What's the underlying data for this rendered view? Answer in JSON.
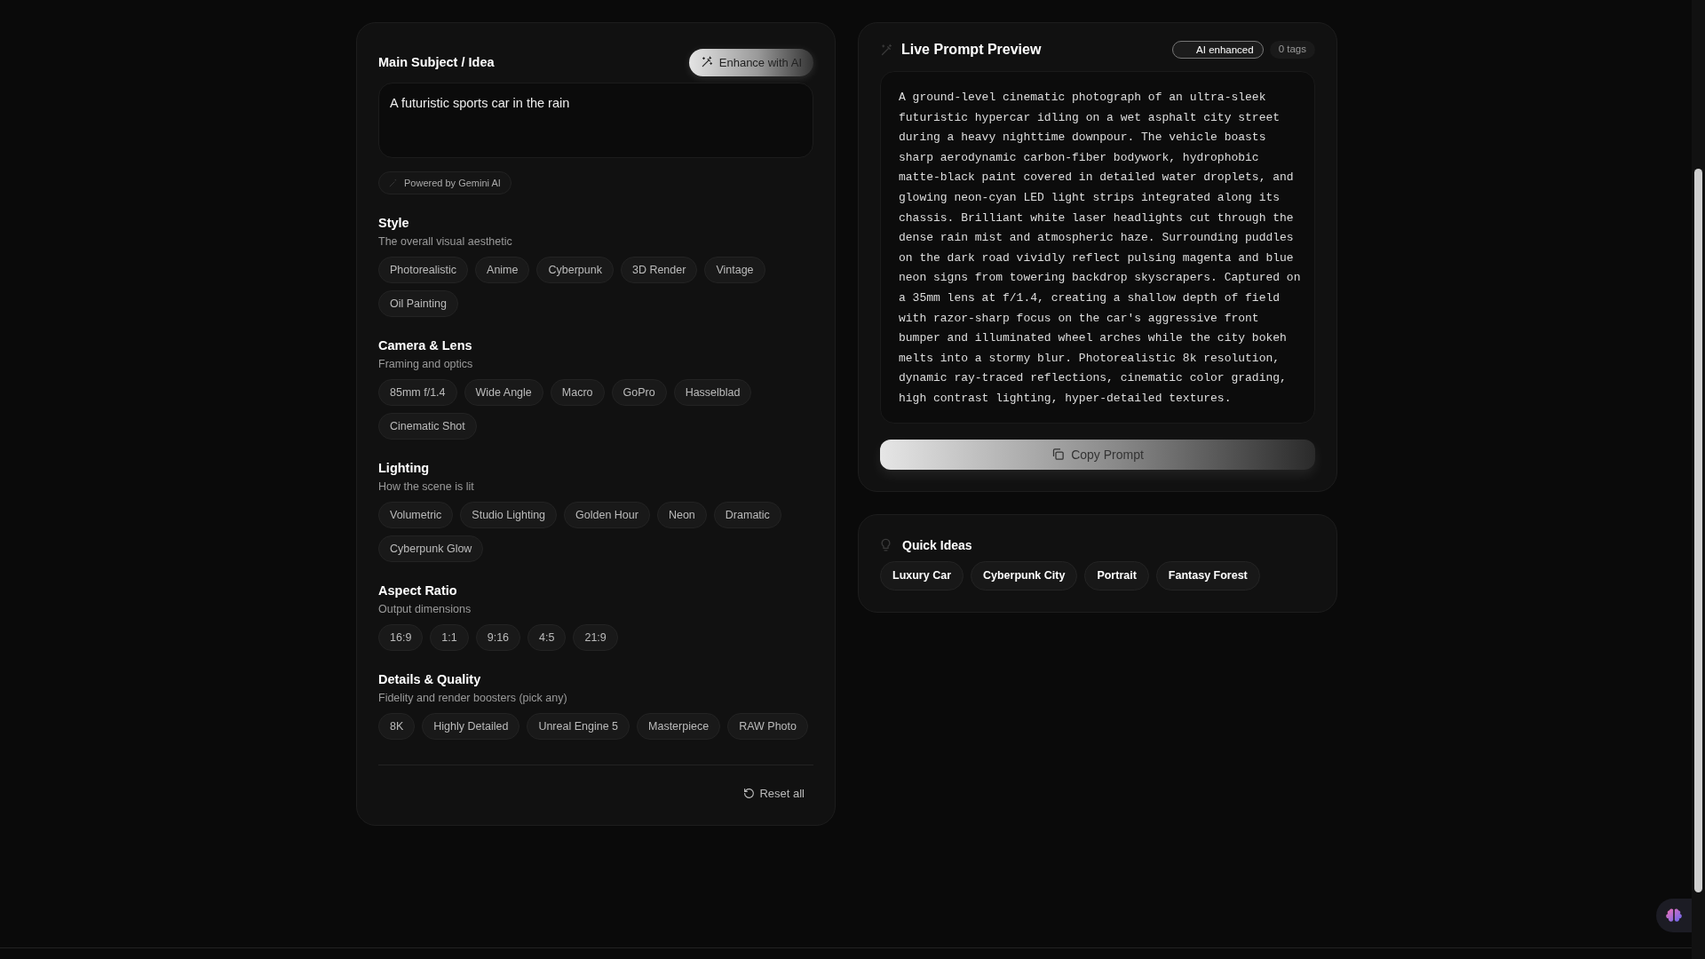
{
  "subject": {
    "title": "Main Subject / Idea",
    "enhance_button": "Enhance with AI",
    "value": "A futuristic sports car in the rain",
    "powered_by": "Powered by Gemini AI"
  },
  "sections": [
    {
      "title": "Style",
      "subtitle": "The overall visual aesthetic",
      "chips": [
        {
          "label": "Photorealistic",
          "selected": false
        },
        {
          "label": "Anime",
          "selected": false
        },
        {
          "label": "Cyberpunk",
          "selected": false
        },
        {
          "label": "3D Render",
          "selected": false
        },
        {
          "label": "Vintage",
          "selected": false
        },
        {
          "label": "Oil Painting",
          "selected": false
        }
      ]
    },
    {
      "title": "Camera & Lens",
      "subtitle": "Framing and optics",
      "chips": [
        {
          "label": "85mm f/1.4",
          "selected": false
        },
        {
          "label": "Wide Angle",
          "selected": false
        },
        {
          "label": "Macro",
          "selected": false
        },
        {
          "label": "GoPro",
          "selected": false
        },
        {
          "label": "Hasselblad",
          "selected": false
        },
        {
          "label": "Cinematic Shot",
          "selected": false
        }
      ]
    },
    {
      "title": "Lighting",
      "subtitle": "How the scene is lit",
      "chips": [
        {
          "label": "Volumetric",
          "selected": false
        },
        {
          "label": "Studio Lighting",
          "selected": false
        },
        {
          "label": "Golden Hour",
          "selected": false
        },
        {
          "label": "Neon",
          "selected": false
        },
        {
          "label": "Dramatic",
          "selected": false
        },
        {
          "label": "Cyberpunk Glow",
          "selected": false
        }
      ]
    },
    {
      "title": "Aspect Ratio",
      "subtitle": "Output dimensions",
      "chips": [
        {
          "label": "16:9",
          "selected": false
        },
        {
          "label": "1:1",
          "selected": false
        },
        {
          "label": "9:16",
          "selected": false
        },
        {
          "label": "4:5",
          "selected": false
        },
        {
          "label": "21:9",
          "selected": false
        }
      ]
    },
    {
      "title": "Details & Quality",
      "subtitle": "Fidelity and render boosters (pick any)",
      "chips": [
        {
          "label": "8K",
          "selected": false
        },
        {
          "label": "Highly Detailed",
          "selected": false
        },
        {
          "label": "Unreal Engine 5",
          "selected": false
        },
        {
          "label": "Masterpiece",
          "selected": false
        },
        {
          "label": "RAW Photo",
          "selected": false
        }
      ]
    }
  ],
  "reset_button": "Reset all",
  "preview": {
    "title": "Live Prompt Preview",
    "ai_badge": "AI enhanced",
    "ai_enhanced": true,
    "tag_count": "0 tags",
    "prompt": "A ground-level cinematic photograph of an ultra-sleek futuristic hypercar idling on a wet asphalt city street during a heavy nighttime downpour. The vehicle boasts sharp aerodynamic carbon-fiber bodywork, hydrophobic matte-black paint covered in detailed water droplets, and glowing neon-cyan LED light strips integrated along its chassis. Brilliant white laser headlights cut through the dense rain mist and atmospheric haze. Surrounding puddles on the dark road vividly reflect pulsing magenta and blue neon signs from towering backdrop skyscrapers. Captured on a 35mm lens at f/1.4, creating a shallow depth of field with razor-sharp focus on the car's aggressive front bumper and illuminated wheel arches while the city bokeh melts into a stormy blur. Photorealistic 8k resolution, dynamic ray-traced reflections, cinematic color grading, high contrast lighting, hyper-detailed textures.",
    "copy_button": "Copy Prompt"
  },
  "quick_ideas": {
    "title": "Quick Ideas",
    "items": [
      "Luxury Car",
      "Cyberpunk City",
      "Portrait",
      "Fantasy Forest"
    ]
  }
}
